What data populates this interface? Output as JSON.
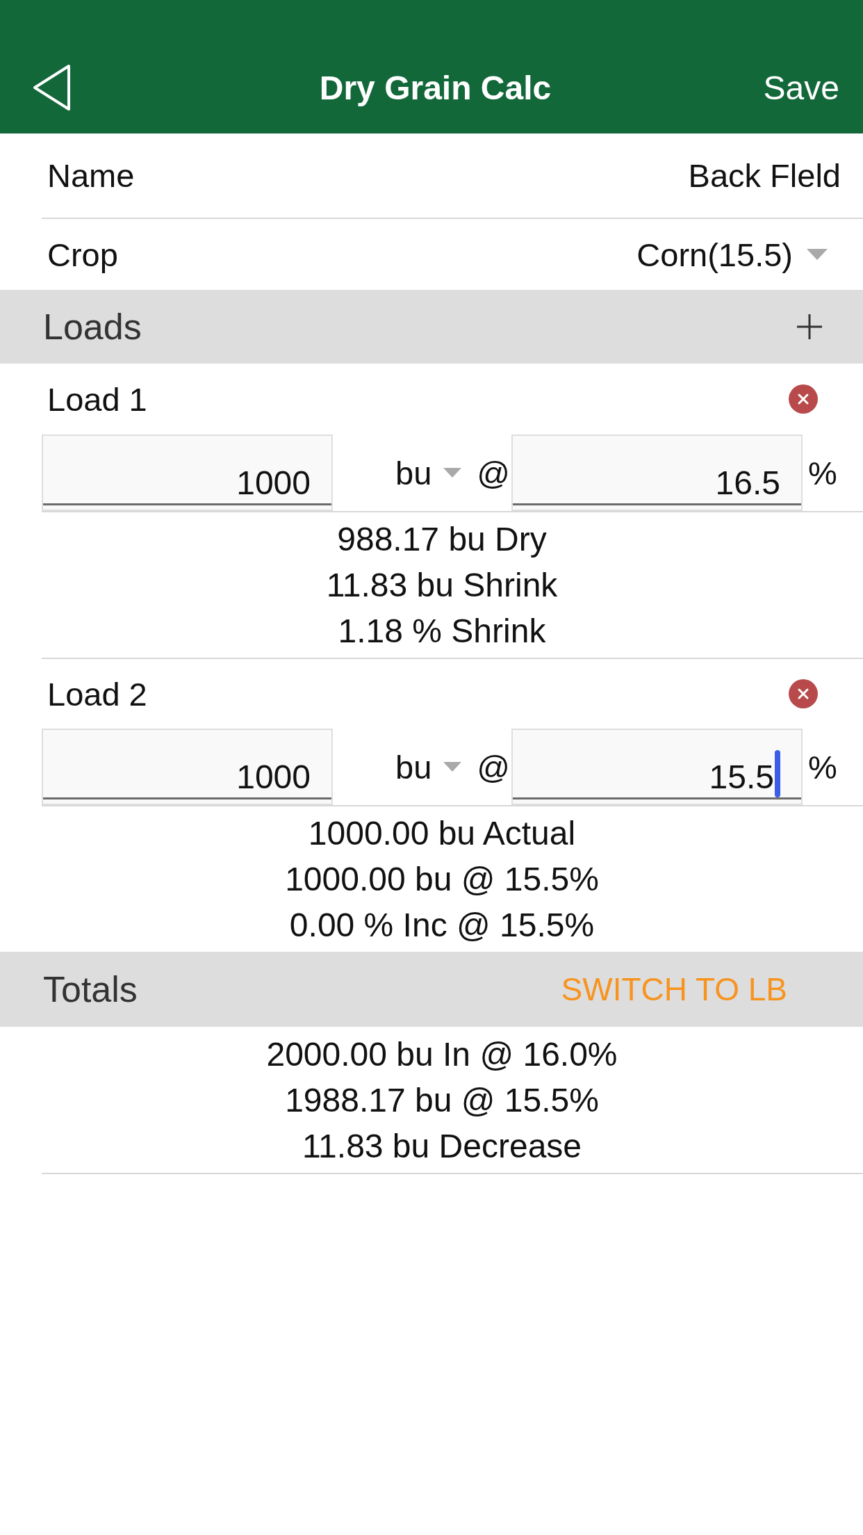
{
  "header": {
    "title": "Dry Grain Calc",
    "action": "Save"
  },
  "fields": [
    {
      "kind": "text",
      "label": "Name",
      "value": "Back Fleld"
    },
    {
      "kind": "dropdown",
      "label": "Crop",
      "value": "Corn(15.5)"
    }
  ],
  "loads_section": {
    "title": "Loads"
  },
  "loads": [
    {
      "title": "Load 1",
      "amount": {
        "value": "1000",
        "focused": false
      },
      "unit": "bu",
      "at": "@",
      "moisture": {
        "value": "16.5",
        "focused": false
      },
      "suffix": "%",
      "results": [
        "988.17 bu Dry",
        "11.83 bu Shrink",
        "1.18 % Shrink"
      ]
    },
    {
      "title": "Load 2",
      "amount": {
        "value": "1000",
        "focused": false
      },
      "unit": "bu",
      "at": "@",
      "moisture": {
        "value": "15.5",
        "focused": true
      },
      "suffix": "%",
      "results": [
        "1000.00 bu Actual",
        "1000.00 bu @ 15.5%",
        "0.00 % Inc @ 15.5%"
      ]
    }
  ],
  "totals": {
    "title": "Totals",
    "action": "SWITCH TO LB",
    "results": [
      "2000.00 bu In @ 16.0%",
      "1988.17 bu @ 15.5%",
      "11.83 bu Decrease"
    ]
  }
}
